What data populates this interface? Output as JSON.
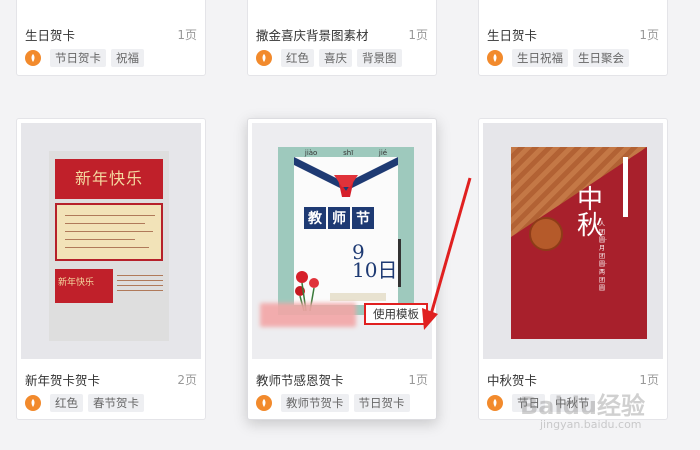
{
  "top_row": [
    {
      "title": "生日贺卡",
      "pages": "1页",
      "tags": [
        "节日贺卡",
        "祝福"
      ]
    },
    {
      "title": "撒金喜庆背景图素材",
      "pages": "1页",
      "tags": [
        "红色",
        "喜庆",
        "背景图"
      ]
    },
    {
      "title": "生日贺卡",
      "pages": "1页",
      "tags": [
        "生日祝福",
        "生日聚会"
      ]
    }
  ],
  "cards": [
    {
      "title": "新年贺卡贺卡",
      "pages": "2页",
      "tags": [
        "红色",
        "春节贺卡"
      ],
      "art": {
        "headline": "新年快乐",
        "card_text": "新年快乐"
      }
    },
    {
      "title": "教师节感恩贺卡",
      "pages": "1页",
      "tags": [
        "教师节贺卡",
        "节日贺卡"
      ],
      "art": {
        "pinyin": [
          "jiào",
          "shī",
          "jié"
        ],
        "headline": [
          "教",
          "师",
          "节"
        ],
        "date": "9\n10日"
      },
      "use_template_label": "使用模板"
    },
    {
      "title": "中秋贺卡",
      "pages": "1页",
      "tags": [
        "节日",
        "中秋节"
      ],
      "art": {
        "headline": "中秋",
        "sub": "人团圆·月团圆·两团圆"
      }
    }
  ],
  "watermark": {
    "brand": "Baidu经验",
    "url": "jingyan.baidu.com"
  },
  "colors": {
    "accent": "#f28a2c",
    "highlight": "#e02020"
  }
}
